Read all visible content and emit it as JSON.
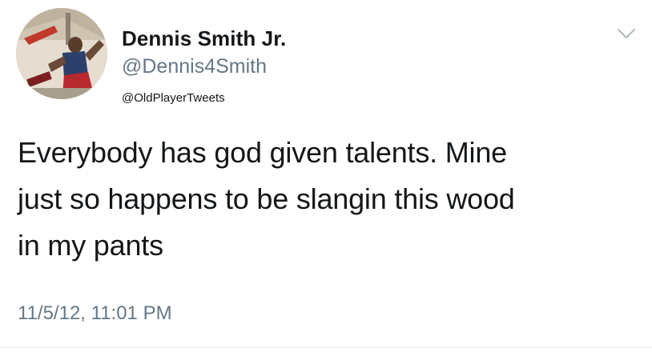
{
  "user": {
    "display_name": "Dennis Smith Jr.",
    "handle": "@Dennis4Smith",
    "avatar_icon": "avatar-photo"
  },
  "watermark": "@OldPlayerTweets",
  "menu": {
    "icon": "chevron-down-icon"
  },
  "tweet": {
    "lines": [
      "Everybody has god given talents. Mine",
      "just so happens to be slangin this wood",
      "in my pants"
    ],
    "timestamp": "11/5/12, 11:01 PM"
  },
  "colors": {
    "text": "#14171a",
    "secondary": "#657786",
    "divider": "#e1e8ed"
  }
}
